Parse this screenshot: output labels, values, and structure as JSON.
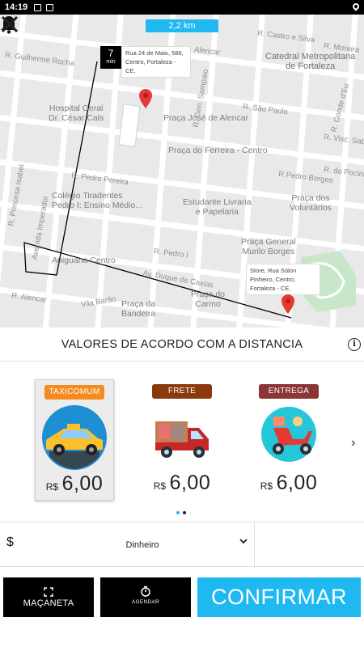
{
  "status_bar": {
    "time": "14:19"
  },
  "map": {
    "distance": "2,2 km",
    "eta": {
      "value": "7",
      "unit": "min"
    },
    "origin_address": "Rua 24 de Maio, 586, Centro, Fortaleza - CE,",
    "destination_address": "Store, Rua Sólon Pinheiro, Centro, Fortaleza - CE,",
    "labels": {
      "hospital": "Hospital Geral\nDr. César Cals",
      "praca_jose": "Praça José de Alencar",
      "praca_ferreira": "Praça do Ferreira - Centro",
      "colegio": "Colégio Tiradentes\nPedro I: Ensino Médio...",
      "estudante": "Estudante Livraria\ne Papelaria",
      "praca_voluntarios": "Praça dos\nVoluntários",
      "catedral": "Catedral Metropolitana\nde Fortaleza",
      "apiguana": "Apiguana Centro",
      "praca_murilo": "Praça General\nMurilo Borges",
      "praca_bandeira": "Praça da\nBandeira",
      "praca_carmo": "Praça do\nCarmo",
      "st_guilherme": "R. Guilherme Rocha",
      "st_castro": "R. Castro e Silva",
      "st_alencar": "Alencar",
      "st_sampaio": "R. Gen. Sampaio",
      "st_sao_paulo": "R. São Paulo",
      "st_conde": "R. Conde d'Eu",
      "st_visc": "R. Visc. Saboia",
      "st_pedro_pereira": "R. Pedro Pereira",
      "st_pedro_borges": "R Pedro Borges",
      "st_pedro_borges2": "R Pedro Borges",
      "st_pedro_i": "R. Pedro I",
      "st_duque": "Av. Duque de Caxias",
      "st_imperador": "Avenida Imperador",
      "st_barao": "Vila Barão",
      "st_princesa": "R. Princesa Isabel",
      "st_moreira": "R. Moreira",
      "st_pocinho": "R. do Pocinho",
      "st_alencar2": "R. Alencar"
    }
  },
  "values_header": {
    "title": "VALORES DE ACORDO COM A DISTANCIA",
    "info_glyph": "i"
  },
  "services": [
    {
      "badge": "TAXICOMUM",
      "badge_color": "#f58a1f",
      "currency": "R$",
      "price": "6,00",
      "icon": "taxi-icon",
      "selected": true
    },
    {
      "badge": "FRETE",
      "badge_color": "#8b3a0e",
      "currency": "R$",
      "price": "6,00",
      "icon": "truck-icon",
      "selected": false
    },
    {
      "badge": "ENTREGA",
      "badge_color": "#8b3535",
      "currency": "R$",
      "price": "6,00",
      "icon": "scooter-icon",
      "selected": false
    }
  ],
  "payment": {
    "currency_symbol": "$",
    "method": "Dinheiro"
  },
  "buttons": {
    "handle": "MAÇANETA",
    "schedule": "AGENDAR",
    "confirm": "CONFIRMAR"
  },
  "colors": {
    "accent": "#1fb8f0",
    "route": "#000000",
    "pin": "#e53935"
  }
}
